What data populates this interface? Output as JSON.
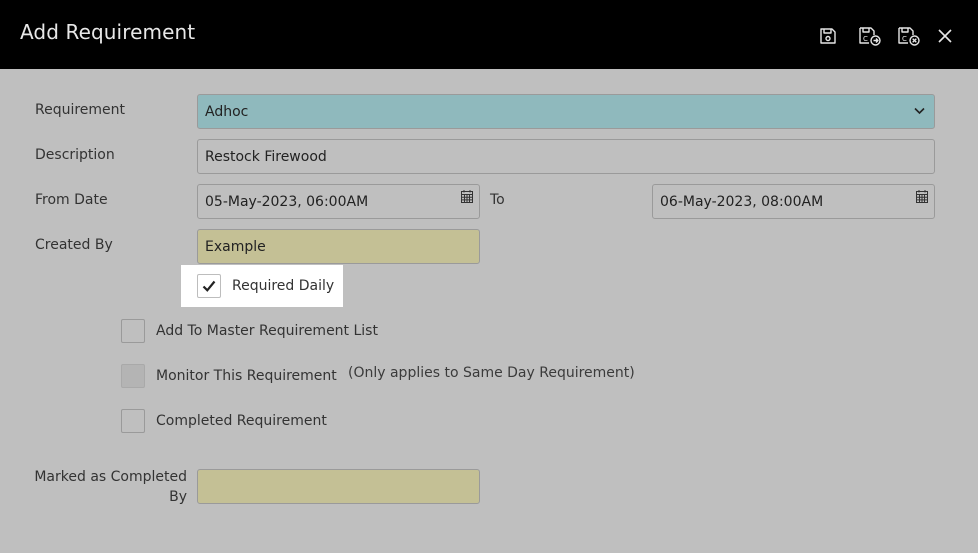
{
  "window": {
    "title": "Add Requirement",
    "icons": [
      "save-icon",
      "save-and-copy-icon",
      "save-and-close-icon",
      "close-icon"
    ]
  },
  "form": {
    "requirement": {
      "label": "Requirement",
      "value": "Adhoc"
    },
    "description": {
      "label": "Description",
      "value": "Restock Firewood"
    },
    "from_date": {
      "label": "From Date",
      "value": "05-May-2023, 06:00AM"
    },
    "to_date": {
      "label": "To",
      "value": "06-May-2023, 08:00AM"
    },
    "created_by": {
      "label": "Created By",
      "value": "Example"
    },
    "required_daily": {
      "label": "Required Daily",
      "checked": true
    },
    "add_to_master": {
      "label": "Add To Master Requirement List",
      "checked": false
    },
    "monitor": {
      "label": "Monitor This Requirement",
      "checked": false,
      "note": "(Only applies to Same Day Requirement)"
    },
    "completed": {
      "label": "Completed Requirement",
      "checked": false
    },
    "marked_completed_by": {
      "label_line1": "Marked as Completed",
      "label_line2": "By",
      "value": ""
    }
  },
  "colors": {
    "header_bg": "#000000",
    "body_bg": "#bfbfbf",
    "select_bg": "#8fb9bd",
    "readonly_bg": "#c4c095"
  }
}
